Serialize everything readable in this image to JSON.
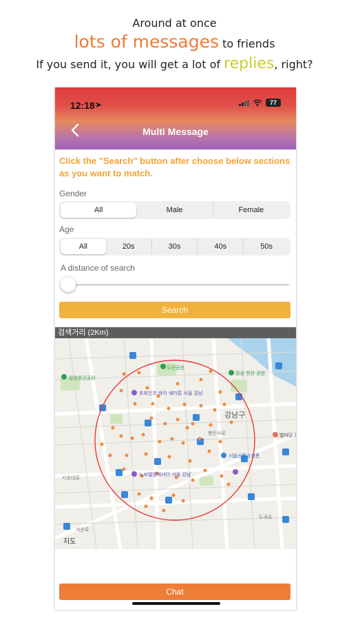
{
  "promo": {
    "line1": "Around at once",
    "line2_highlight": "lots of messages",
    "line2_rest": " to friends",
    "line3_start": "If you send it, you will get a lot of ",
    "line3_highlight": "replies",
    "line3_end": ", right?"
  },
  "status_bar": {
    "time": "12:18",
    "battery": "77"
  },
  "header": {
    "title": "Multi Message"
  },
  "instruction": "Click the \"Search\" button  after choose below sections as you want to match.",
  "gender": {
    "label": "Gender",
    "options": [
      "All",
      "Male",
      "Female"
    ],
    "selected": "All"
  },
  "age": {
    "label": "Age",
    "options": [
      "All",
      "20s",
      "30s",
      "40s",
      "50s"
    ],
    "selected": "All"
  },
  "distance": {
    "label": "A distance of search",
    "level": 0
  },
  "search_button": "Search",
  "map": {
    "header": "검색거리 (2Km)",
    "district": "강남구",
    "places": [
      "도산공원",
      "잠원한강공원",
      "포포인츠 바이 쉐라톤 서울 강남",
      "노보텔앰배서더 서울 강남",
      "서울선릉과정릉",
      "잠실 한강 공원",
      "별마당 도"
    ],
    "roads": [
      "봉은사로",
      "도곡로",
      "서초대로",
      "서운로"
    ],
    "attribution": "지도"
  },
  "chat_button": "Chat",
  "colors": {
    "accent_orange": "#ee7d38",
    "search_yellow": "#f0b23b",
    "replies_green": "#c7cf2d",
    "radius_red": "#e53935"
  }
}
